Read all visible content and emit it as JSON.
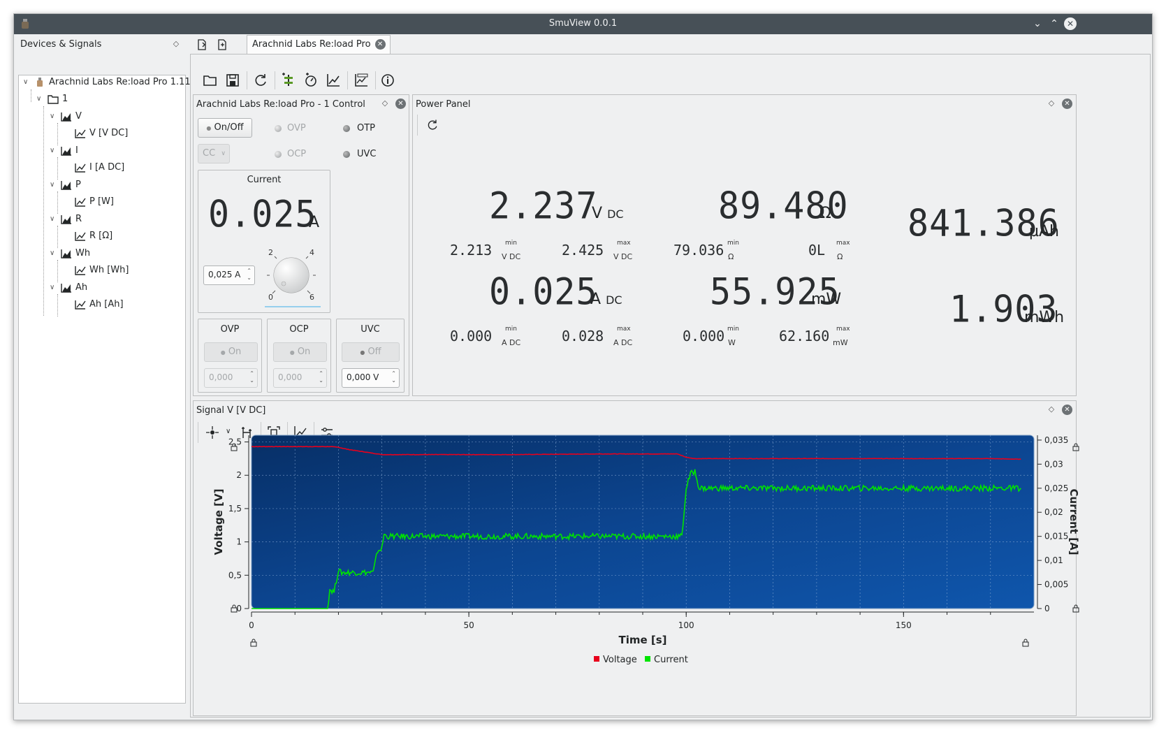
{
  "window": {
    "title": "SmuView 0.0.1"
  },
  "devices_panel": {
    "title": "Devices & Signals",
    "device": "Arachnid Labs Re:load Pro 1.11 ...",
    "channel": "1",
    "signals": [
      {
        "name": "V",
        "child": "V [V DC]"
      },
      {
        "name": "I",
        "child": "I [A DC]"
      },
      {
        "name": "P",
        "child": "P [W]"
      },
      {
        "name": "R",
        "child": "R [Ω]"
      },
      {
        "name": "Wh",
        "child": "Wh [Wh]"
      },
      {
        "name": "Ah",
        "child": "Ah [Ah]"
      }
    ]
  },
  "tab": {
    "label": "Arachnid Labs Re:load Pro"
  },
  "control": {
    "title": "Arachnid Labs Re:load Pro - 1 Control",
    "onoff": "On/Off",
    "mode": "CC",
    "ovp": "OVP",
    "otp": "OTP",
    "ocp": "OCP",
    "uvc": "UVC",
    "current_group": "Current",
    "current_value": "0.025",
    "current_unit": "A",
    "current_spin": "0,025 A",
    "knob_ticks": [
      "2",
      "4",
      "0",
      "6"
    ],
    "ovp_group": {
      "title": "OVP",
      "btn": "On",
      "spin": "0,000"
    },
    "ocp_group": {
      "title": "OCP",
      "btn": "On",
      "spin": "0,000"
    },
    "uvc_group": {
      "title": "UVC",
      "btn": "Off",
      "spin": "0,000 V"
    }
  },
  "power_panel": {
    "title": "Power Panel",
    "voltage": {
      "value": "2.237",
      "unit": "V",
      "sub": "DC",
      "min": "2.213",
      "max": "2.425",
      "min_unit": "V DC",
      "max_unit": "V DC"
    },
    "resistance": {
      "value": "89.480",
      "unit": "Ω",
      "min": "79.036",
      "max": "0L",
      "min_unit": "Ω",
      "max_unit": "Ω"
    },
    "current": {
      "value": "0.025",
      "unit": "A",
      "sub": "DC",
      "min": "0.000",
      "max": "0.028",
      "min_unit": "A DC",
      "max_unit": "A DC"
    },
    "power": {
      "value": "55.925",
      "unit": "mW",
      "min": "0.000",
      "max": "62.160",
      "min_unit": "W",
      "max_unit": "mW"
    },
    "charge": {
      "value": "841.386",
      "unit": "µAh"
    },
    "energy": {
      "value": "1.903",
      "unit": "mWh"
    },
    "min_label": "min",
    "max_label": "max"
  },
  "signal_panel": {
    "title": "Signal V [V DC]"
  },
  "chart_data": {
    "type": "line",
    "xlabel": "Time [s]",
    "ylabel": "Voltage [V]",
    "y2label": "Current [A]",
    "xlim": [
      0,
      180
    ],
    "ylim": [
      0,
      2.6
    ],
    "y2lim": [
      0,
      0.036
    ],
    "x_ticks": [
      "0",
      "50",
      "100",
      "150"
    ],
    "y_ticks": [
      "0",
      "0,5",
      "1",
      "1,5",
      "2",
      "2,5"
    ],
    "y2_ticks": [
      "0",
      "0,005",
      "0,01",
      "0,015",
      "0,02",
      "0,025",
      "0,03",
      "0,035"
    ],
    "series": [
      {
        "name": "Voltage",
        "color": "#e8001c",
        "axis": "left",
        "x": [
          0,
          18,
          20,
          22,
          26,
          30,
          40,
          60,
          80,
          98,
          100,
          102,
          110,
          130,
          150,
          170,
          177
        ],
        "y": [
          2.43,
          2.43,
          2.42,
          2.39,
          2.35,
          2.31,
          2.31,
          2.31,
          2.32,
          2.32,
          2.27,
          2.25,
          2.25,
          2.25,
          2.25,
          2.25,
          2.24
        ]
      },
      {
        "name": "Current",
        "color": "#00e400",
        "axis": "right",
        "x": [
          0,
          17.5,
          18,
          19,
          20,
          20.5,
          28,
          29,
          30,
          30.5,
          31,
          40,
          60,
          80,
          99,
          99.5,
          100,
          101,
          102,
          103,
          104,
          110,
          130,
          150,
          170,
          177
        ],
        "y": [
          0,
          0,
          0.004,
          0.0035,
          0.008,
          0.0075,
          0.0075,
          0.012,
          0.0125,
          0.0155,
          0.015,
          0.015,
          0.015,
          0.015,
          0.015,
          0.02,
          0.025,
          0.028,
          0.0285,
          0.025,
          0.025,
          0.025,
          0.025,
          0.025,
          0.025,
          0.025
        ]
      }
    ]
  }
}
